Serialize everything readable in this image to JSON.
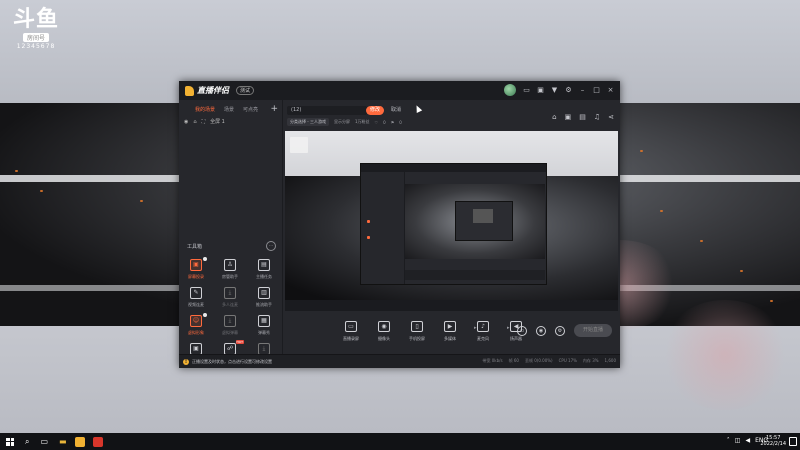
{
  "overlay": {
    "logo_big": "斗鱼",
    "logo_room": "房间号",
    "logo_num": "12345678"
  },
  "app": {
    "name": "直播伴侣",
    "version_btn": "测试",
    "sidebar": {
      "tabs": [
        "我的场景",
        "场景",
        "可点亮"
      ],
      "scene_label": "全屏 1",
      "tools_title": "工具箱",
      "tools": [
        {
          "label": "屏幕投录",
          "icon": "▣"
        },
        {
          "label": "房管助手",
          "icon": "♙"
        },
        {
          "label": "主播任务",
          "icon": "▤"
        },
        {
          "label": "视频连麦",
          "icon": "✎"
        },
        {
          "label": "多人连麦",
          "icon": "⤓"
        },
        {
          "label": "推流助手",
          "icon": "▥"
        },
        {
          "label": "虚拟形象",
          "icon": "☺"
        },
        {
          "label": "虚拟弹幕",
          "icon": "⤓"
        },
        {
          "label": "弹幕秀",
          "icon": "▦"
        },
        {
          "label": "",
          "icon": "▣"
        },
        {
          "label": "",
          "icon": "☍"
        },
        {
          "label": "",
          "icon": "⤓"
        }
      ]
    },
    "main": {
      "title_value": "(12)",
      "modify_btn": "修改",
      "cancel_btn": "取消",
      "category": "分类选择 - 三人游戏",
      "info1": "显示分屏",
      "info2": "1万粉丝",
      "info3": "0",
      "info4": "0"
    },
    "bottombar": {
      "items": [
        {
          "label": "直播录屏",
          "icon": "▭"
        },
        {
          "label": "摄像头",
          "icon": "◉"
        },
        {
          "label": "手机投屏",
          "icon": "▯"
        },
        {
          "label": "多媒体",
          "icon": "▶"
        },
        {
          "label": "麦克风",
          "icon": "♪"
        },
        {
          "label": "扬声器",
          "icon": "◀"
        }
      ],
      "live_btn": "开始直播"
    },
    "status": {
      "message": "正播设置及时状态，点击进行设置可修改设置",
      "stats": [
        "带宽 0kb/s",
        "帧 60",
        "丢帧 0(0.00%)",
        "CPU 17%",
        "内存 3%",
        "1,600"
      ]
    }
  },
  "taskbar": {
    "lang": "ENG",
    "time": "15:57",
    "date": "2022/2/14"
  }
}
